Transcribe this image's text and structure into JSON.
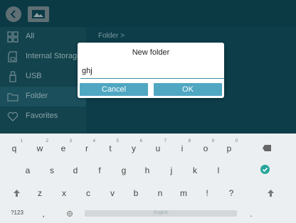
{
  "topbar": {
    "back_icon": "chevron-left-icon",
    "image_icon": "image-icon"
  },
  "sidebar": {
    "items": [
      {
        "label": "All",
        "icon": "grid-icon"
      },
      {
        "label": "Internal Storage",
        "icon": "sd-card-icon"
      },
      {
        "label": "USB",
        "icon": "usb-icon"
      },
      {
        "label": "Folder",
        "icon": "folder-icon"
      },
      {
        "label": "Favorites",
        "icon": "heart-icon"
      }
    ]
  },
  "main": {
    "breadcrumb": "Folder >"
  },
  "dialog": {
    "title": "New folder",
    "input_value": "ghj",
    "cancel_label": "Cancel",
    "ok_label": "OK"
  },
  "keyboard": {
    "row1": [
      {
        "k": "q",
        "s": "1"
      },
      {
        "k": "w",
        "s": "2"
      },
      {
        "k": "e",
        "s": "3"
      },
      {
        "k": "r",
        "s": "4"
      },
      {
        "k": "t",
        "s": "5"
      },
      {
        "k": "y",
        "s": "6"
      },
      {
        "k": "u",
        "s": "7"
      },
      {
        "k": "i",
        "s": "8"
      },
      {
        "k": "o",
        "s": "9"
      },
      {
        "k": "p",
        "s": "0"
      }
    ],
    "row2": [
      "a",
      "s",
      "d",
      "f",
      "g",
      "h",
      "j",
      "k",
      "l"
    ],
    "row3": [
      "z",
      "x",
      "c",
      "v",
      "b",
      "n",
      "m",
      "!",
      "?"
    ],
    "symbols_label": "?123",
    "comma": ",",
    "space_label": "English",
    "period": ".",
    "accent_color": "#26a69a"
  }
}
